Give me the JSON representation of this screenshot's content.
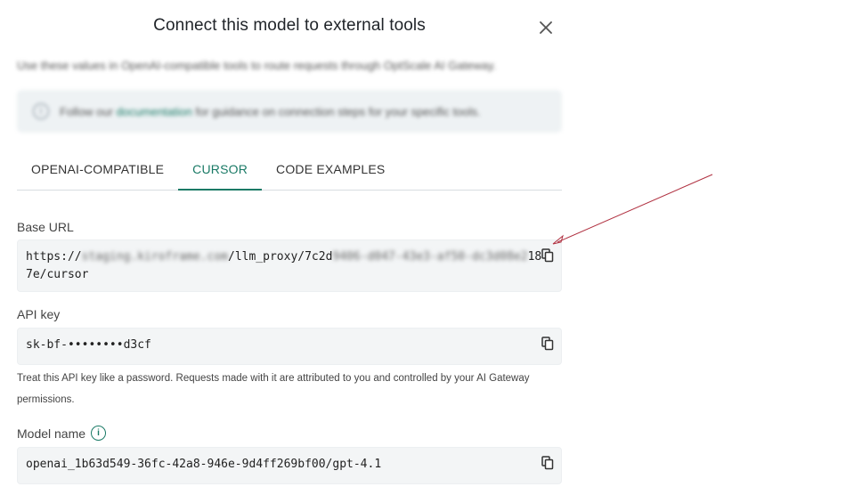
{
  "dialog": {
    "title": "Connect this model to external tools",
    "subtitle": "Use these values in OpenAI-compatible tools to route requests through OptScale AI Gateway.",
    "info": {
      "prefix": "Follow our ",
      "link": "documentation",
      "suffix": " for guidance on connection steps for your specific tools."
    }
  },
  "tabs": [
    {
      "label": "OPENAI-COMPATIBLE",
      "active": false
    },
    {
      "label": "CURSOR",
      "active": true
    },
    {
      "label": "CODE EXAMPLES",
      "active": false
    }
  ],
  "fields": {
    "base_url": {
      "label": "Base URL",
      "part1": "https://",
      "part2_masked": "staging.kiroframe.com",
      "part3": "/llm_proxy/7c2d",
      "part4_masked": "9406-d047-43e3-af50-dc3d08e2",
      "part5": "18",
      "line2": "7e/cursor"
    },
    "api_key": {
      "label": "API key",
      "value": "sk-bf-••••••••d3cf",
      "helper": "Treat this API key like a password. Requests made with it are attributed to you and controlled by your AI Gateway permissions."
    },
    "model_name": {
      "label": "Model name",
      "value": "openai_1b63d549-36fc-42a8-946e-9d4ff269bf00/gpt-4.1"
    }
  },
  "icons": {
    "close": "close-icon",
    "copy": "copy-icon",
    "info": "info-icon"
  },
  "colors": {
    "accent": "#1a7a66",
    "field_bg": "#f3f5f6",
    "annotation_arrow": "#b03040"
  }
}
